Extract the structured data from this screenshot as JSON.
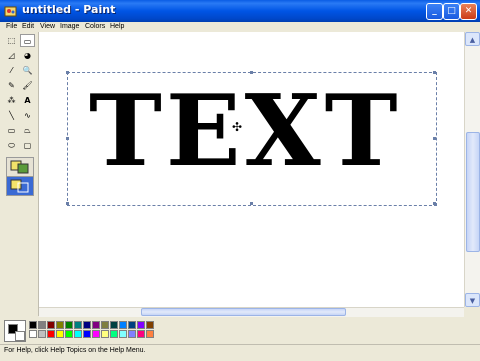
{
  "window": {
    "title": "untitled - Paint",
    "minimize_glyph": "_",
    "maximize_glyph": "□",
    "close_glyph": "✕"
  },
  "menu": [
    "File",
    "Edit",
    "View",
    "Image",
    "Colors",
    "Help"
  ],
  "tools": [
    {
      "name": "free-form-select",
      "glyph": "⬚"
    },
    {
      "name": "select",
      "glyph": "▭",
      "selected": true
    },
    {
      "name": "eraser",
      "glyph": "◿"
    },
    {
      "name": "fill",
      "glyph": "◕"
    },
    {
      "name": "pick-color",
      "glyph": "⁄"
    },
    {
      "name": "magnifier",
      "glyph": "🔍"
    },
    {
      "name": "pencil",
      "glyph": "✎"
    },
    {
      "name": "brush",
      "glyph": "🖌"
    },
    {
      "name": "airbrush",
      "glyph": "⁂"
    },
    {
      "name": "text",
      "glyph": "A"
    },
    {
      "name": "line",
      "glyph": "╲"
    },
    {
      "name": "curve",
      "glyph": "∿"
    },
    {
      "name": "rectangle",
      "glyph": "▭"
    },
    {
      "name": "polygon",
      "glyph": "⏢"
    },
    {
      "name": "ellipse",
      "glyph": "⬭"
    },
    {
      "name": "rounded-rectangle",
      "glyph": "▢"
    }
  ],
  "canvas": {
    "text": "TEXT"
  },
  "scrollbar_glyphs": {
    "up": "▲",
    "down": "▼",
    "left": "◀",
    "right": "▶"
  },
  "cursor_glyph": "✣",
  "palette": {
    "foreground": "#000000",
    "background": "#ffffff",
    "colors_row1": [
      "#000000",
      "#808080",
      "#800000",
      "#808000",
      "#008000",
      "#008080",
      "#000080",
      "#800080",
      "#808040",
      "#004040",
      "#0080ff",
      "#004080",
      "#8000ff",
      "#804000"
    ],
    "colors_row2": [
      "#ffffff",
      "#c0c0c0",
      "#ff0000",
      "#ffff00",
      "#00ff00",
      "#00ffff",
      "#0000ff",
      "#ff00ff",
      "#ffff80",
      "#00ff80",
      "#80ffff",
      "#8080ff",
      "#ff0080",
      "#ff8040"
    ]
  },
  "status": "For Help, click Help Topics on the Help Menu."
}
